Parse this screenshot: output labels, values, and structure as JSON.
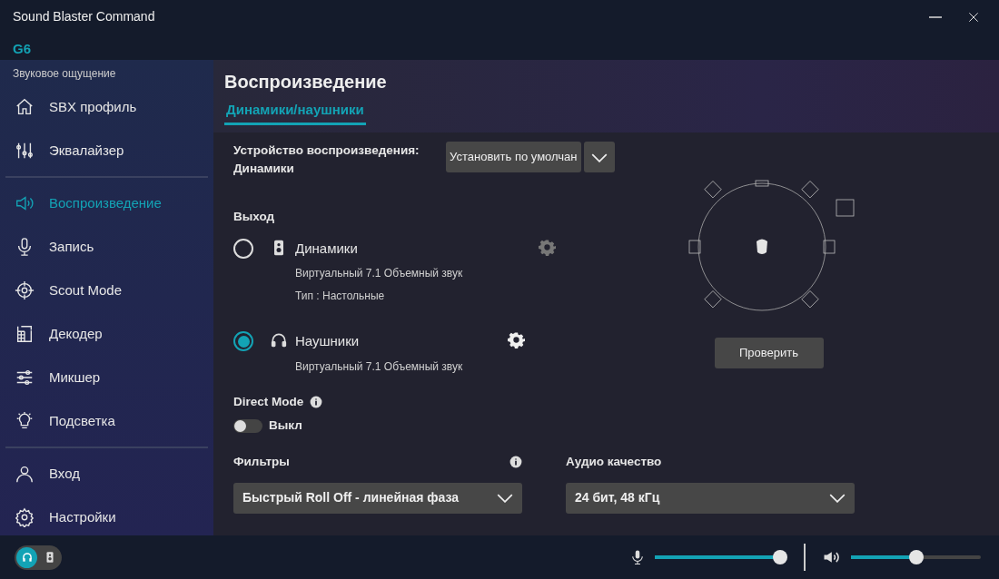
{
  "window": {
    "title": "Sound Blaster Command",
    "device": "G6"
  },
  "sidebar": {
    "section_label": "Звуковое ощущение",
    "groups": [
      [
        {
          "label": "SBX профиль",
          "selected": false
        },
        {
          "label": "Эквалайзер",
          "selected": false
        }
      ],
      [
        {
          "label": "Воспроизведение",
          "selected": true
        },
        {
          "label": "Запись",
          "selected": false
        },
        {
          "label": "Scout Mode",
          "selected": false
        },
        {
          "label": "Декодер",
          "selected": false
        },
        {
          "label": "Микшер",
          "selected": false
        },
        {
          "label": "Подсветка",
          "selected": false
        }
      ],
      [
        {
          "label": "Вход",
          "selected": false
        },
        {
          "label": "Настройки",
          "selected": false
        }
      ]
    ]
  },
  "page": {
    "title": "Воспроизведение",
    "tabs": [
      {
        "label": "Динамики/наушники",
        "selected": true
      }
    ]
  },
  "playback_device": {
    "label": "Устройство воспроизведения:",
    "value": "Динамики",
    "button": "Установить по умолчан"
  },
  "output": {
    "label": "Выход",
    "options": [
      {
        "name": "Динамики",
        "selected": false,
        "details": [
          "Виртуальный 7.1 Объемный звук",
          "Тип :  Настольные"
        ]
      },
      {
        "name": "Наушники",
        "selected": true,
        "details": [
          "Виртуальный 7.1 Объемный звук"
        ]
      }
    ]
  },
  "test_button": "Проверить",
  "direct_mode": {
    "label": "Direct Mode",
    "on": false,
    "state_label": "Выкл"
  },
  "filters": {
    "label": "Фильтры",
    "value": "Быстрый Roll Off - линейная фаза"
  },
  "audio_quality": {
    "label": "Аудио качество",
    "value": "24 бит, 48 кГц"
  },
  "bottom_bar": {
    "output_switch": [
      {
        "selected": true
      },
      {
        "selected": false
      }
    ],
    "mic_volume": {
      "level": 1.0
    },
    "speaker_volume": {
      "level": 0.5
    }
  }
}
